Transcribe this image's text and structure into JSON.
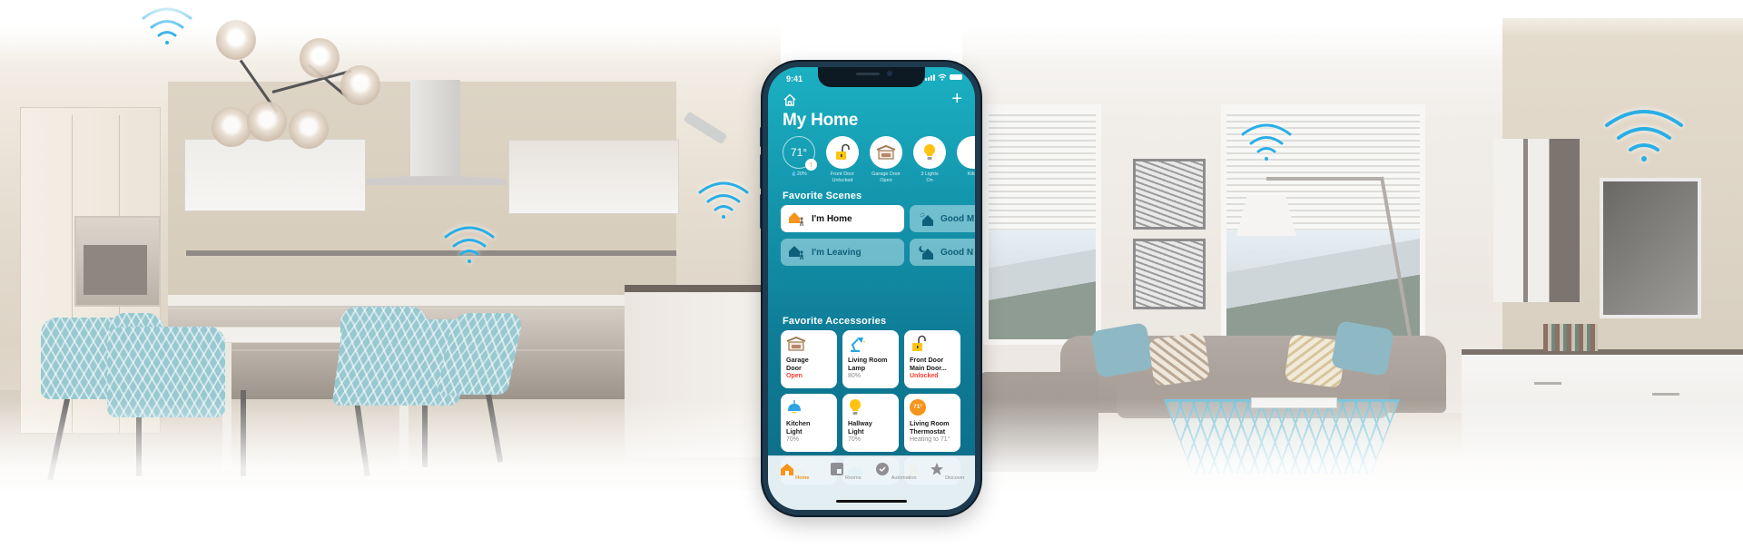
{
  "scene": {
    "description": "Smart home interior with kitchen on the left and living room on the right",
    "wifi_color": "#29aee6"
  },
  "phone": {
    "status_bar": {
      "time": "9:41"
    },
    "header": {
      "home_icon": "house-icon",
      "add_icon": "plus-icon",
      "title": "My Home"
    },
    "status_items": [
      {
        "primary": "71°",
        "secondary": "20%",
        "icon": "thermostat-ring",
        "badge": "↑"
      },
      {
        "label_line1": "Front Door",
        "label_line2": "Unlocked",
        "icon": "lock-open-icon"
      },
      {
        "label_line1": "Garage Door",
        "label_line2": "Open",
        "icon": "garage-icon"
      },
      {
        "label_line1": "3 Lights",
        "label_line2": "On",
        "icon": "lightbulb-icon"
      },
      {
        "label_line1": "Kitch",
        "label_line2": "",
        "icon": "partial-icon"
      }
    ],
    "scenes": {
      "title": "Favorite Scenes",
      "items": [
        {
          "label": "I'm Home",
          "active": true
        },
        {
          "label": "Good M",
          "active": false
        },
        {
          "label": "I'm Leaving",
          "active": false
        },
        {
          "label": "Good N",
          "active": false
        }
      ]
    },
    "accessories": {
      "title": "Favorite Accessories",
      "items": [
        {
          "name_line1": "Garage",
          "name_line2": "Door",
          "status": "Open",
          "alert": true,
          "icon": "garage-icon"
        },
        {
          "name_line1": "Living Room",
          "name_line2": "Lamp",
          "status": "80%",
          "alert": false,
          "icon": "desk-lamp-icon"
        },
        {
          "name_line1": "Front Door",
          "name_line2": "Main Door...",
          "status": "Unlocked",
          "alert": true,
          "icon": "lock-open-icon"
        },
        {
          "name_line1": "Kitchen",
          "name_line2": "Light",
          "status": "70%",
          "alert": false,
          "icon": "pendant-light-icon"
        },
        {
          "name_line1": "Hallway",
          "name_line2": "Light",
          "status": "70%",
          "alert": false,
          "icon": "lightbulb-icon"
        },
        {
          "name_line1": "Living Room",
          "name_line2": "Thermostat",
          "status": "Heating to 71°",
          "alert": false,
          "icon": "thermostat-icon",
          "icon_text": "71°"
        }
      ]
    },
    "tabbar": {
      "items": [
        {
          "label": "Home",
          "active": true,
          "icon": "house-icon"
        },
        {
          "label": "Rooms",
          "active": false,
          "icon": "rooms-icon"
        },
        {
          "label": "Automation",
          "active": false,
          "icon": "clock-check-icon"
        },
        {
          "label": "Discover",
          "active": false,
          "icon": "star-icon"
        }
      ]
    },
    "colors": {
      "accent_orange": "#f7941d",
      "alert_red": "#ff3b30",
      "screen_teal": "#1496ad"
    }
  }
}
